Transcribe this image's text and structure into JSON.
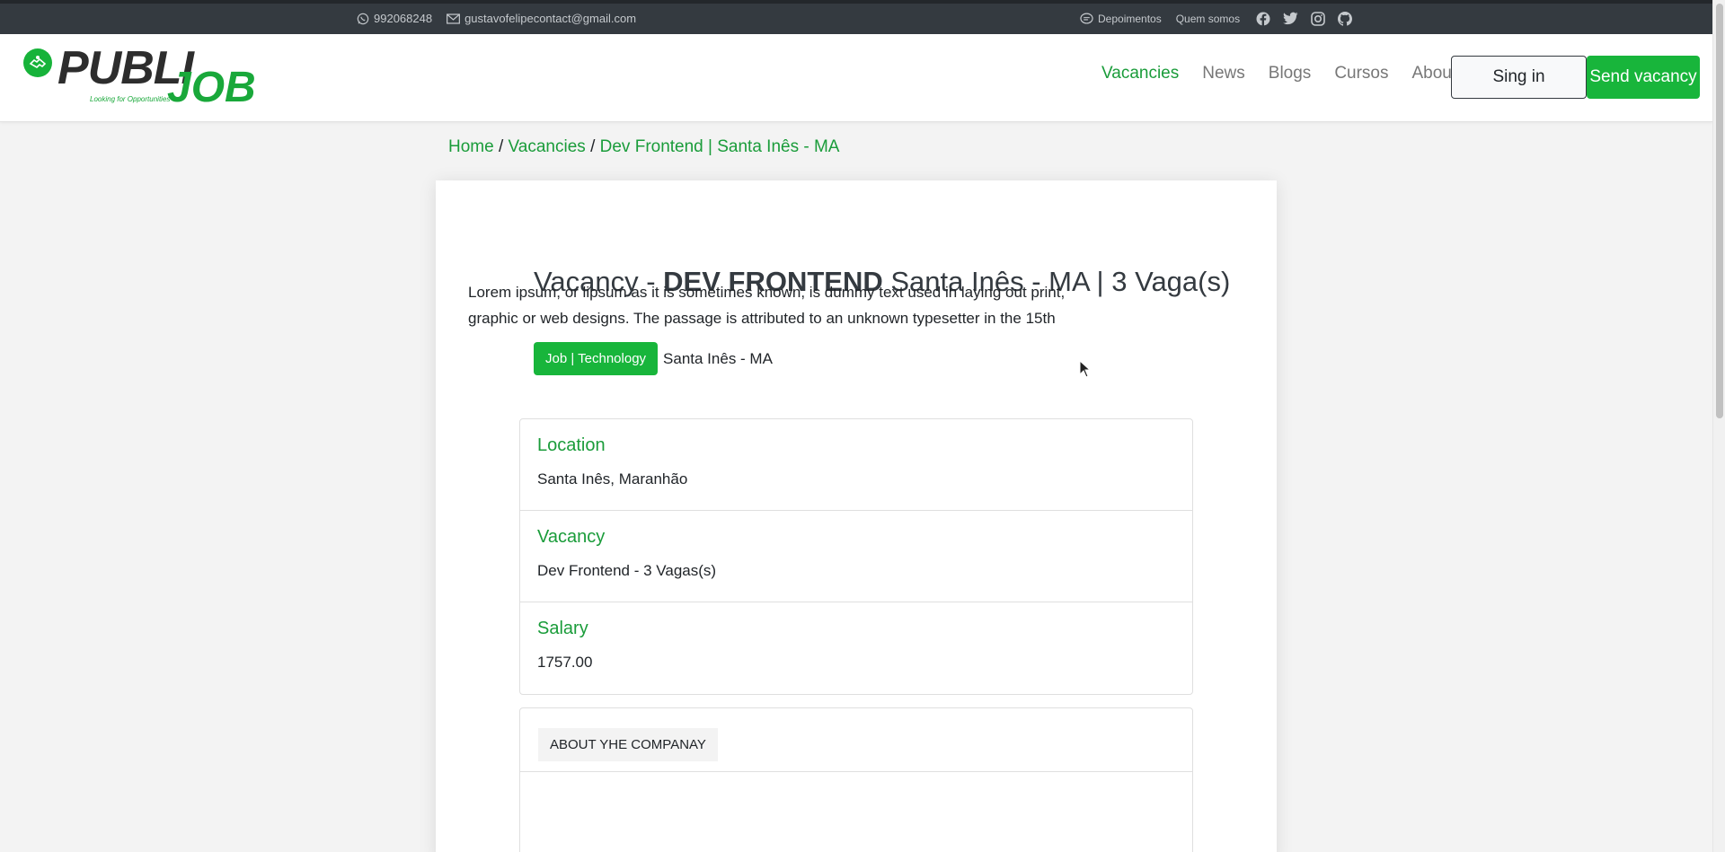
{
  "topbar": {
    "phone": "992068248",
    "email": "gustavofelipecontact@gmail.com",
    "testimonials": "Depoimentos",
    "about_us": "Quem somos",
    "social_icons": [
      "facebook-icon",
      "twitter-icon",
      "instagram-icon",
      "github-icon"
    ]
  },
  "brand": {
    "name_part1": "PUBLI",
    "name_part2": "JOB",
    "tagline": "Looking for Opportunities",
    "accent_color": "#18b53b"
  },
  "nav": {
    "items": [
      {
        "label": "Vacancies",
        "active": true
      },
      {
        "label": "News",
        "active": false
      },
      {
        "label": "Blogs",
        "active": false
      },
      {
        "label": "Cursos",
        "active": false
      },
      {
        "label": "About",
        "active": false
      }
    ],
    "signin_label": "Sing in",
    "send_vacancy_label": "Send vacancy"
  },
  "breadcrumb": {
    "home": "Home",
    "vacancies": "Vacancies",
    "current": "Dev Frontend | Santa Inês - MA",
    "separator": "/"
  },
  "vacancy": {
    "title_prefix": "Vacancy -",
    "title_role": "DEV FRONTEND",
    "title_suffix": "Santa Inês - MA | 3 Vaga(s)",
    "category_badge": "Job | Technology",
    "tag_location": "Santa Inês - MA",
    "details": [
      {
        "label": "Location",
        "value": "Santa Inês, Maranhão"
      },
      {
        "label": "Vacancy",
        "value": "Dev Frontend - 3 Vagas(s)"
      },
      {
        "label": "Salary",
        "value": "1757.00"
      }
    ],
    "about_tab": "ABOUT YHE COMPANAY",
    "about_text": "Lorem ipsum, or lipsum as it is sometimes known, is dummy text used in laying out print, graphic or web designs. The passage is attributed to an unknown typesetter in the 15th"
  }
}
